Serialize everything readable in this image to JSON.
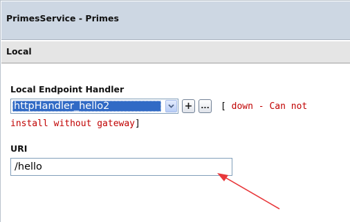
{
  "header": {
    "title": "PrimesService - Primes"
  },
  "section": {
    "title": "Local"
  },
  "endpoint": {
    "label": "Local Endpoint Handler",
    "selected_value": "httpHandler_hello2",
    "add_button": "+",
    "browse_button": "...",
    "status_open": "[",
    "status_line1": "down -  Can not",
    "status_line2": "install without gateway",
    "status_close": "]"
  },
  "uri": {
    "label": "URI",
    "value": "/hello"
  },
  "colors": {
    "title_bar": "#cdd7e3",
    "section_bar": "#e5e5e5",
    "status_red": "#c00000",
    "selection_blue": "#316ac5",
    "annotation_arrow": "#e8383b"
  },
  "icons": {
    "dropdown": "chevron-down-icon",
    "annotation": "red-arrow-annotation"
  }
}
